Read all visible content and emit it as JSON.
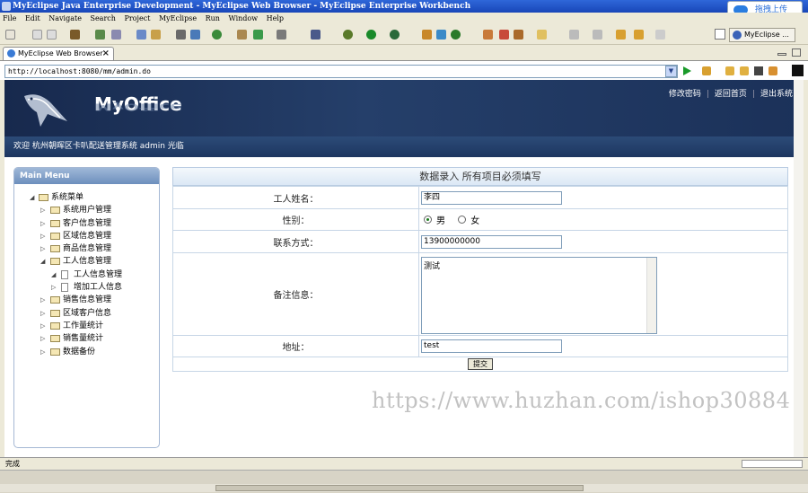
{
  "window": {
    "title": "MyEclipse Java Enterprise Development - MyEclipse Web Browser - MyEclipse Enterprise Workbench",
    "upload_label": "拖拽上传"
  },
  "menu": [
    "File",
    "Edit",
    "Navigate",
    "Search",
    "Project",
    "MyEclipse",
    "Run",
    "Window",
    "Help"
  ],
  "toolbar": {
    "perspective_label": "MyEclipse ..."
  },
  "editor_tab": {
    "label": "MyEclipse Web Browser"
  },
  "browser": {
    "url": "http://localhost:8080/mm/admin.do"
  },
  "site": {
    "logo": "MyOffice",
    "top_links": [
      "修改密码",
      "返回首页",
      "退出系统"
    ],
    "welcome": "欢迎 杭州朝晖区卡叭配送管理系统 admin 光临"
  },
  "sidebar": {
    "title": "Main Menu",
    "root": "系统菜单",
    "items": [
      {
        "label": "系统用户管理",
        "level": 1,
        "expanded": false,
        "type": "folder"
      },
      {
        "label": "客户信息管理",
        "level": 1,
        "expanded": false,
        "type": "folder"
      },
      {
        "label": "区域信息管理",
        "level": 1,
        "expanded": false,
        "type": "folder"
      },
      {
        "label": "商品信息管理",
        "level": 1,
        "expanded": false,
        "type": "folder"
      },
      {
        "label": "工人信息管理",
        "level": 1,
        "expanded": true,
        "type": "folder"
      },
      {
        "label": "工人信息管理",
        "level": 2,
        "expanded": true,
        "type": "page"
      },
      {
        "label": "增加工人信息",
        "level": 2,
        "expanded": false,
        "type": "page"
      },
      {
        "label": "销售信息管理",
        "level": 1,
        "expanded": false,
        "type": "folder"
      },
      {
        "label": "区域客户信息",
        "level": 1,
        "expanded": false,
        "type": "folder"
      },
      {
        "label": "工作量统计",
        "level": 1,
        "expanded": false,
        "type": "folder"
      },
      {
        "label": "销售量统计",
        "level": 1,
        "expanded": false,
        "type": "folder"
      },
      {
        "label": "数据备份",
        "level": 1,
        "expanded": false,
        "type": "folder"
      }
    ]
  },
  "form": {
    "header": "数据录入 所有项目必须填写",
    "name_label": "工人姓名：",
    "name_value": "李四",
    "gender_label": "性别：",
    "gender_male": "男",
    "gender_female": "女",
    "gender_selected": "男",
    "phone_label": "联系方式：",
    "phone_value": "13900000000",
    "remark_label": "备注信息：",
    "remark_value": "测试",
    "address_label": "地址：",
    "address_value": "test",
    "submit_label": "提交"
  },
  "watermark": "https://www.huzhan.com/ishop30884",
  "status": {
    "text": "完成"
  },
  "colors": {
    "banner": "#1b3159",
    "titlebar": "#2f67d9",
    "accent_green": "#1a7a1a"
  }
}
